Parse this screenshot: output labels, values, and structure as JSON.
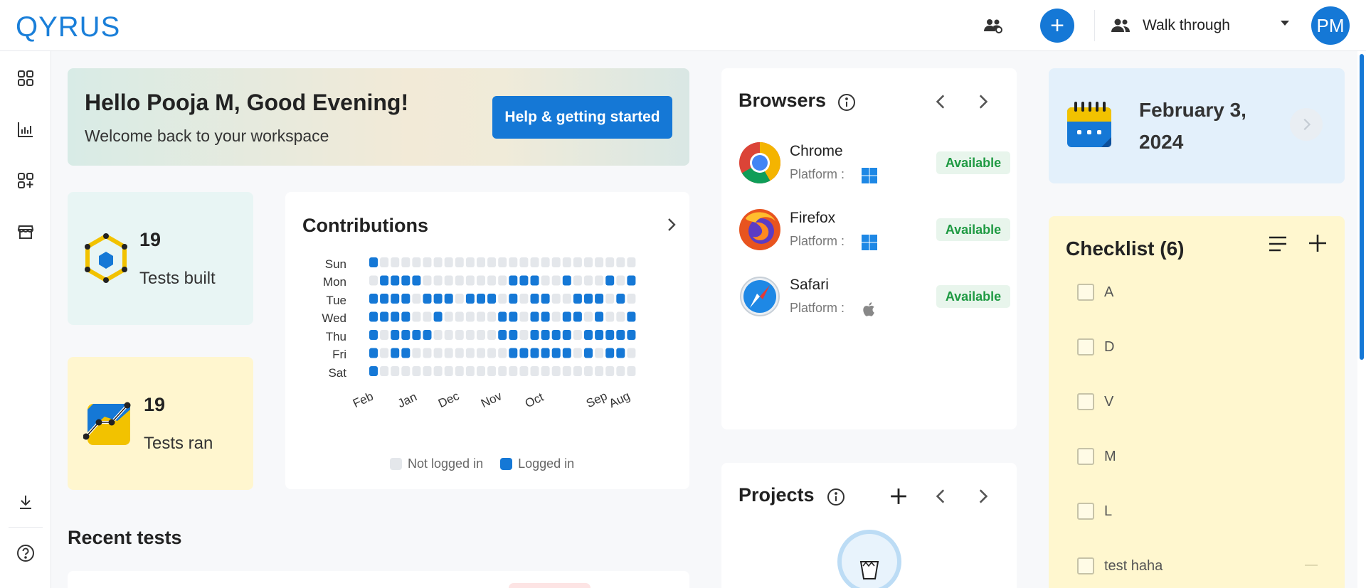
{
  "header": {
    "logo_text": "QYRUS",
    "team_icon": "team-settings-icon",
    "add_icon": "plus-icon",
    "workspace_label": "Walk through",
    "avatar_initials": "PM",
    "accent_color": "#1578d6"
  },
  "sidebar": {
    "items": [
      {
        "icon": "dashboard-grid-icon"
      },
      {
        "icon": "bar-chart-icon"
      },
      {
        "icon": "add-module-icon"
      },
      {
        "icon": "store-icon"
      },
      {
        "icon": "download-icon"
      },
      {
        "icon": "help-circle-icon"
      }
    ]
  },
  "banner": {
    "greeting": "Hello Pooja M, Good Evening!",
    "subtitle": "Welcome back to your workspace",
    "button_label": "Help & getting started"
  },
  "stats": {
    "built": {
      "value": "19",
      "label": "Tests built",
      "icon": "hexagon-network-icon"
    },
    "ran": {
      "value": "19",
      "label": "Tests ran",
      "icon": "chart-line-icon"
    }
  },
  "contributions": {
    "title": "Contributions",
    "days": [
      "Sun",
      "Mon",
      "Tue",
      "Wed",
      "Thu",
      "Fri",
      "Sat"
    ],
    "months": [
      "Feb",
      "Jan",
      "Dec",
      "Nov",
      "Oct",
      "Sep",
      "Aug"
    ],
    "legend_not_logged": "Not logged in",
    "legend_logged": "Logged in",
    "color_logged": "#1578d6",
    "color_not_logged": "#e4e7eb",
    "grid": [
      "1000000000000000000000000",
      "0111100000000111001000101",
      "1111011101110101100111010",
      "1111001000001101101101001",
      "1011110000001101111011111",
      "1011000000000111111010110",
      "1000000000000000000000000"
    ]
  },
  "recent": {
    "title": "Recent tests"
  },
  "browsers": {
    "title": "Browsers",
    "platform_prefix": "Platform :",
    "items": [
      {
        "name": "Chrome",
        "platform": "windows",
        "status": "Available"
      },
      {
        "name": "Firefox",
        "platform": "windows",
        "status": "Available"
      },
      {
        "name": "Safari",
        "platform": "apple",
        "status": "Available"
      }
    ]
  },
  "projects": {
    "title": "Projects"
  },
  "date_card": {
    "date": "February 3, 2024"
  },
  "checklist": {
    "title": "Checklist (6)",
    "items": [
      "A",
      "D",
      "V",
      "M",
      "L",
      "test haha"
    ]
  }
}
